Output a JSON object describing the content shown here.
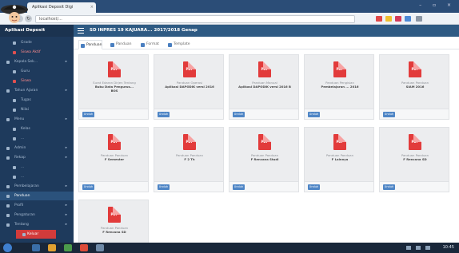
{
  "browser": {
    "tab_title": "Aplikasi Deposit Digi",
    "tab_close": "×",
    "address": "localhost/...",
    "window_controls": "– ▫ ×",
    "nav_back": "‹",
    "nav_reload": "↻"
  },
  "app": {
    "name": "Aplikasi Deposit",
    "page_title": "SD INPRES 19 KAJUARA... 2017/2018 Genap"
  },
  "sidebar": {
    "items": [
      {
        "label": "Grade",
        "style": "sub"
      },
      {
        "label": "Siswa Aktif",
        "style": "sub-danger"
      },
      {
        "label": "Kepala Sek...",
        "style": "normal"
      },
      {
        "label": "Guru",
        "style": "sub"
      },
      {
        "label": "Siswa",
        "style": "sub-danger"
      },
      {
        "label": "Tahun Ajaran",
        "style": "normal"
      },
      {
        "label": "Tugas",
        "style": "sub"
      },
      {
        "label": "Nilai",
        "style": "sub"
      },
      {
        "label": "Menu",
        "style": "normal"
      },
      {
        "label": "Kelas",
        "style": "sub"
      },
      {
        "label": "...",
        "style": "sub"
      },
      {
        "label": "Admin",
        "style": "normal"
      },
      {
        "label": "Rekap",
        "style": "normal"
      },
      {
        "label": "...",
        "style": "sub"
      },
      {
        "label": "...",
        "style": "sub"
      },
      {
        "label": "Pembelajaran",
        "style": "normal"
      },
      {
        "label": "Panduan",
        "style": "active"
      },
      {
        "label": "Profil",
        "style": "normal"
      },
      {
        "label": "Pengaturan",
        "style": "normal"
      },
      {
        "label": "Tentang",
        "style": "normal"
      },
      {
        "label": "Keluar",
        "style": "btn"
      }
    ]
  },
  "tabs": [
    {
      "label": "Panduan",
      "active": true
    },
    {
      "label": "Panduan",
      "active": false
    },
    {
      "label": "Format",
      "active": false
    },
    {
      "label": "Template",
      "active": false
    }
  ],
  "cards": [
    {
      "line1": "Surat Edaran Dirjen Tentang",
      "line2": "Buku Data Pengurus...",
      "line3": "BOS"
    },
    {
      "line1": "Panduan Operasi",
      "line2": "Aplikasi DAPODIK versi 2016",
      "line3": ""
    },
    {
      "line1": "Panduan Manual",
      "line2": "Aplikasi DAPODIK versi 2016 B",
      "line3": ""
    },
    {
      "line1": "Panduan Pengisian",
      "line2": "Pembelajaran ... 2016",
      "line3": ""
    },
    {
      "line1": "Panduan Panduan",
      "line2": "SIAM 2016",
      "line3": ""
    },
    {
      "line1": "Panduan Panduan",
      "line2": "F Semester",
      "line3": ""
    },
    {
      "line1": "Panduan Panduan",
      "line2": "F 2 Th",
      "line3": ""
    },
    {
      "line1": "Panduan Panduan",
      "line2": "F Rencana Studi",
      "line3": ""
    },
    {
      "line1": "Panduan Panduan",
      "line2": "F Lainnya",
      "line3": ""
    },
    {
      "line1": "Panduan Panduan",
      "line2": "F Rencana SD",
      "line3": ""
    },
    {
      "line1": "Panduan Panduan",
      "line2": "F Rencana SD",
      "line3": ""
    }
  ],
  "download_label": "Unduh",
  "pdf_label": "PDF",
  "taskbar": {
    "clock": "10:45"
  }
}
